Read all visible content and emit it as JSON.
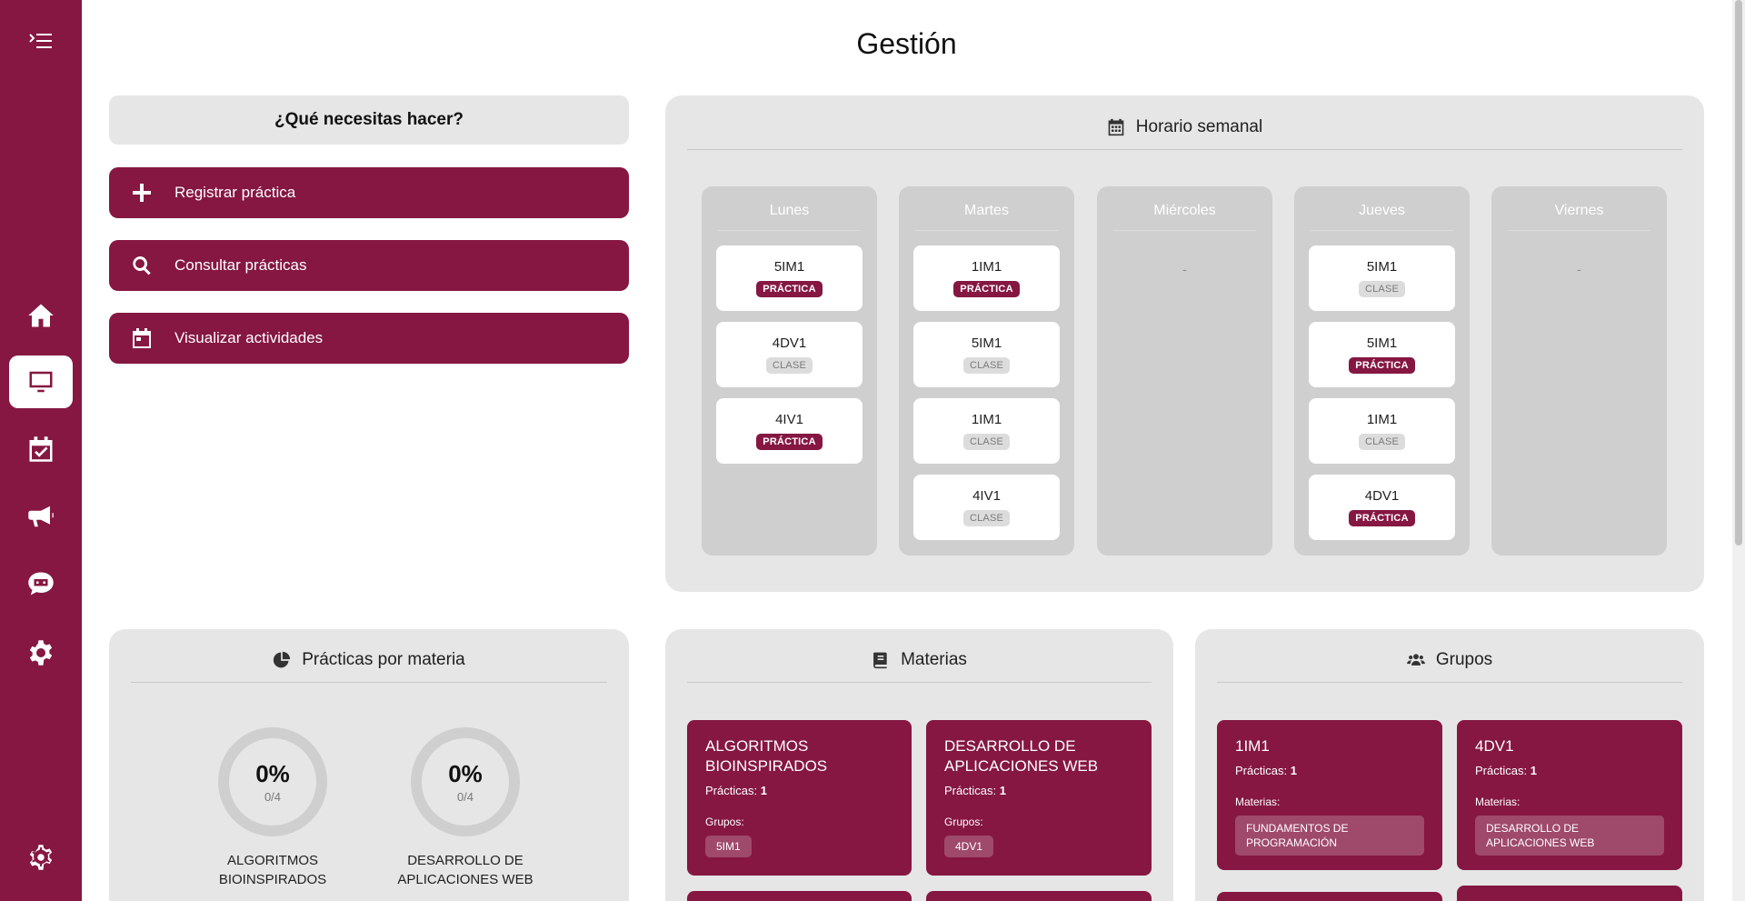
{
  "page": {
    "title": "Gestión"
  },
  "sidebar": {
    "items": [
      {
        "name": "toggle-menu-button",
        "icon": "menu-toggle-icon"
      },
      {
        "name": "sidebar-item-home",
        "icon": "home-icon"
      },
      {
        "name": "sidebar-item-dashboard",
        "icon": "monitor-icon",
        "active": true
      },
      {
        "name": "sidebar-item-calendar",
        "icon": "calendar-check-icon"
      },
      {
        "name": "sidebar-item-announcements",
        "icon": "megaphone-icon"
      },
      {
        "name": "sidebar-item-chat",
        "icon": "chat-icon"
      },
      {
        "name": "sidebar-item-settings",
        "icon": "gear-icon"
      },
      {
        "name": "sidebar-item-config",
        "icon": "cog-outline-icon"
      }
    ]
  },
  "actions": {
    "question": "¿Qué necesitas hacer?",
    "buttons": [
      {
        "label": "Registrar práctica",
        "icon": "plus-icon"
      },
      {
        "label": "Consultar prácticas",
        "icon": "search-icon"
      },
      {
        "label": "Visualizar actividades",
        "icon": "calendar-icon"
      }
    ]
  },
  "schedule": {
    "title": "Horario semanal",
    "icon": "calendar-icon",
    "empty_text": "-",
    "days": [
      {
        "name": "Lunes",
        "slots": [
          {
            "group": "5IM1",
            "type": "PRÁCTICA"
          },
          {
            "group": "4DV1",
            "type": "CLASE"
          },
          {
            "group": "4IV1",
            "type": "PRÁCTICA"
          }
        ]
      },
      {
        "name": "Martes",
        "slots": [
          {
            "group": "1IM1",
            "type": "PRÁCTICA"
          },
          {
            "group": "5IM1",
            "type": "CLASE"
          },
          {
            "group": "1IM1",
            "type": "CLASE"
          },
          {
            "group": "4IV1",
            "type": "CLASE"
          }
        ]
      },
      {
        "name": "Miércoles",
        "slots": []
      },
      {
        "name": "Jueves",
        "slots": [
          {
            "group": "5IM1",
            "type": "CLASE"
          },
          {
            "group": "5IM1",
            "type": "PRÁCTICA"
          },
          {
            "group": "1IM1",
            "type": "CLASE"
          },
          {
            "group": "4DV1",
            "type": "PRÁCTICA"
          }
        ]
      },
      {
        "name": "Viernes",
        "slots": []
      }
    ]
  },
  "practicas_por_materia": {
    "title": "Prácticas por materia",
    "icon": "pie-chart-icon",
    "items": [
      {
        "percent": "0%",
        "fraction": "0/4",
        "progress": 0,
        "label": "ALGORITMOS BIOINSPIRADOS"
      },
      {
        "percent": "0%",
        "fraction": "0/4",
        "progress": 0,
        "label": "DESARROLLO DE APLICACIONES WEB"
      }
    ]
  },
  "materias": {
    "title": "Materias",
    "icon": "book-icon",
    "practicas_label": "Prácticas:",
    "grupos_label": "Grupos:",
    "cards": [
      {
        "title": "ALGORITMOS BIOINSPIRADOS",
        "practicas": "1",
        "grupos": [
          "5IM1"
        ]
      },
      {
        "title": "DESARROLLO DE APLICACIONES WEB",
        "practicas": "1",
        "grupos": [
          "4DV1"
        ]
      }
    ]
  },
  "grupos": {
    "title": "Grupos",
    "icon": "users-icon",
    "practicas_label": "Prácticas:",
    "materias_label": "Materias:",
    "cards": [
      {
        "title": "1IM1",
        "practicas": "1",
        "materias": [
          "FUNDAMENTOS DE PROGRAMACIÓN"
        ]
      },
      {
        "title": "4DV1",
        "practicas": "1",
        "materias": [
          "DESARROLLO DE APLICACIONES WEB"
        ]
      }
    ]
  },
  "colors": {
    "primary": "#851742",
    "panel": "#e6e6e6",
    "day_column": "#cfcfcf"
  }
}
